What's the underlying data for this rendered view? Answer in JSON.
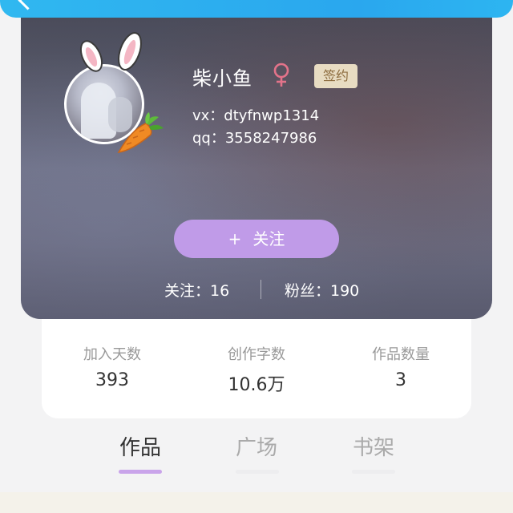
{
  "header": {
    "back_icon": "back-arrow-icon",
    "color": "#2aa7ee"
  },
  "profile": {
    "name": "柴小鱼",
    "gender_icon": "female-icon",
    "gender_color": "#e3738a",
    "badge": "签约",
    "vx": "vx：dtyfnwp1314",
    "qq": "qq：3558247986",
    "follow_button": {
      "plus": "+",
      "label": "关注",
      "color": "#c09be8"
    },
    "following": "关注：16",
    "fans": "粉丝：190"
  },
  "stats": [
    {
      "label": "加入天数",
      "value": "393"
    },
    {
      "label": "创作字数",
      "value": "10.6万"
    },
    {
      "label": "作品数量",
      "value": "3"
    }
  ],
  "tabs": [
    {
      "label": "作品",
      "active": true
    },
    {
      "label": "广场",
      "active": false
    },
    {
      "label": "书架",
      "active": false
    }
  ],
  "accent_color": "#c9a4ea"
}
